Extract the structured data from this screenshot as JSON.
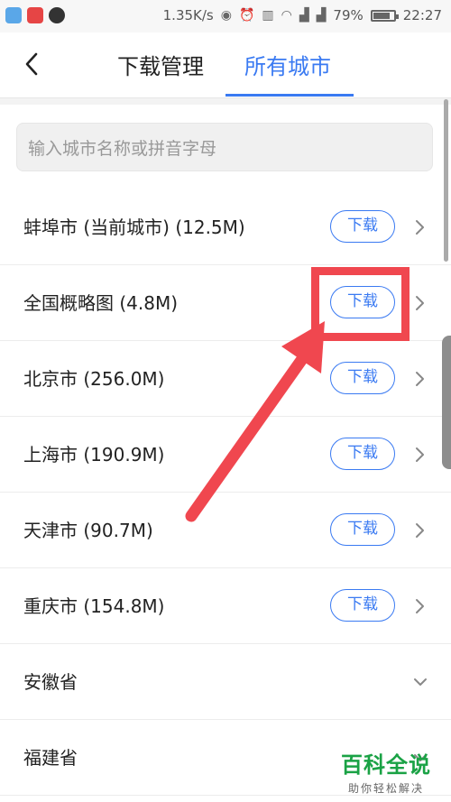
{
  "status_bar": {
    "net_speed": "1.35K/s",
    "battery": "79%",
    "time": "22:27",
    "app_icons": [
      "shield-app-icon",
      "weibo-app-icon",
      "qq-icon"
    ]
  },
  "header": {
    "back_icon": "chevron-left-icon",
    "tabs": [
      {
        "label": "下载管理",
        "active": false
      },
      {
        "label": "所有城市",
        "active": true
      }
    ]
  },
  "search": {
    "placeholder": "输入城市名称或拼音字母"
  },
  "cities": [
    {
      "label": "蚌埠市 (当前城市) (12.5M)",
      "button": "下载",
      "icon": "chevron-right-icon"
    },
    {
      "label": "全国概略图 (4.8M)",
      "button": "下载",
      "icon": "chevron-right-icon"
    },
    {
      "label": "北京市 (256.0M)",
      "button": "下载",
      "icon": "chevron-right-icon"
    },
    {
      "label": "上海市 (190.9M)",
      "button": "下载",
      "icon": "chevron-right-icon"
    },
    {
      "label": "天津市 (90.7M)",
      "button": "下载",
      "icon": "chevron-right-icon"
    },
    {
      "label": "重庆市 (154.8M)",
      "button": "下载",
      "icon": "chevron-right-icon"
    },
    {
      "label": "安徽省",
      "icon": "chevron-down-icon"
    },
    {
      "label": "福建省",
      "icon": "chevron-down-icon"
    }
  ],
  "colors": {
    "accent": "#3a7af2",
    "annotation": "#f0474f",
    "watermark": "#1aa245"
  },
  "watermark": {
    "title": "百科全说",
    "subtitle": "助你轻松解决"
  }
}
